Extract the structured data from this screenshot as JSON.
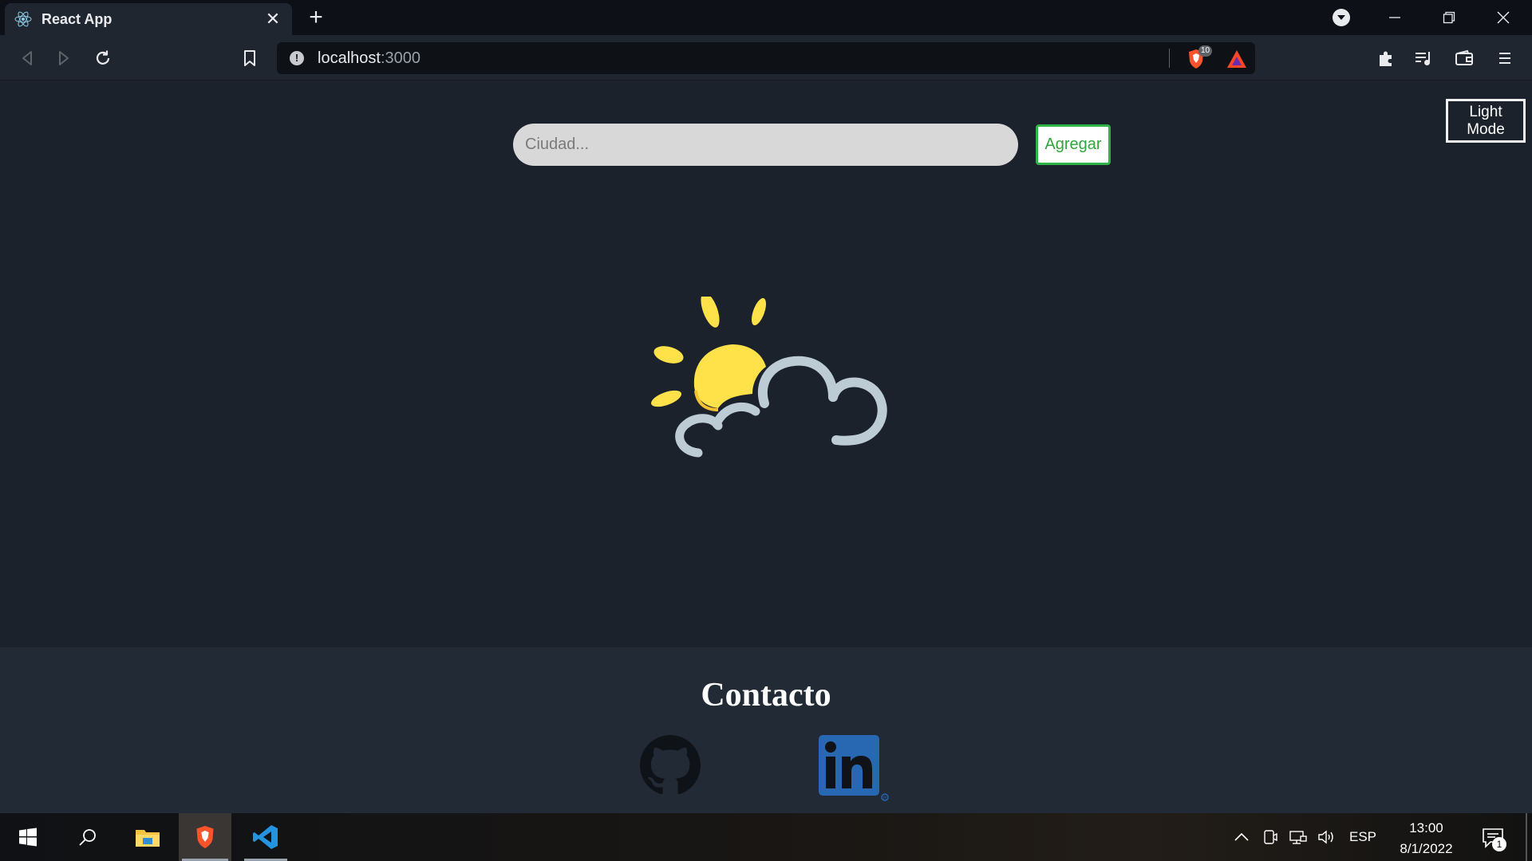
{
  "browser": {
    "tab": {
      "title": "React App",
      "favicon": "react-icon",
      "close_glyph": "✕"
    },
    "newtab_glyph": "+",
    "address": {
      "host": "localhost",
      "port": ":3000"
    },
    "shield_count": "10",
    "toolbar_icons": [
      "back-icon",
      "forward-icon",
      "reload-icon",
      "bookmark-icon",
      "extensions-icon",
      "playlist-icon",
      "wallet-icon",
      "menu-icon"
    ]
  },
  "page": {
    "theme_toggle": {
      "line1": "Light",
      "line2": "Mode"
    },
    "search": {
      "placeholder": "Ciudad..."
    },
    "add_button": {
      "label": "Agregar"
    },
    "illustration": "sun-behind-cloud-icon",
    "colors": {
      "background": "#1b222c",
      "footer": "#212a35",
      "accent_green": "#2fb344",
      "sun": "#ffe14a",
      "cloud": "#bccbd4"
    }
  },
  "footer": {
    "heading": "Contacto",
    "links": [
      {
        "name": "github",
        "icon": "github-icon"
      },
      {
        "name": "linkedin",
        "icon": "linkedin-icon"
      }
    ]
  },
  "taskbar": {
    "apps": [
      "windows-start-icon",
      "search-icon",
      "file-explorer-icon",
      "brave-browser-icon",
      "vscode-icon"
    ],
    "language": "ESP",
    "time": "13:00",
    "date": "8/1/2022",
    "notifications": "1"
  }
}
